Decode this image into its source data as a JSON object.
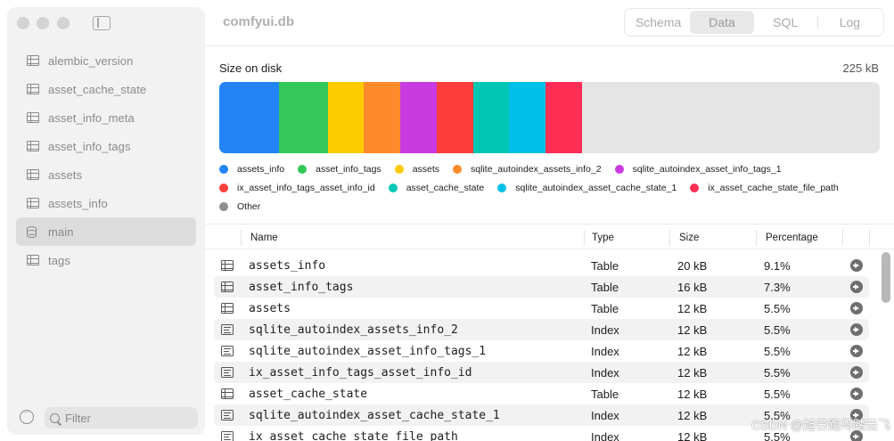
{
  "window": {
    "title": "comfyui.db"
  },
  "tabs": [
    {
      "label": "Schema",
      "active": false
    },
    {
      "label": "Data",
      "active": true
    },
    {
      "label": "SQL",
      "active": false
    },
    {
      "label": "Log",
      "active": false
    }
  ],
  "sidebar": {
    "items": [
      {
        "label": "alembic_version",
        "icon": "table-icon",
        "selected": false
      },
      {
        "label": "asset_cache_state",
        "icon": "table-icon",
        "selected": false
      },
      {
        "label": "asset_info_meta",
        "icon": "table-icon",
        "selected": false
      },
      {
        "label": "asset_info_tags",
        "icon": "table-icon",
        "selected": false
      },
      {
        "label": "assets",
        "icon": "table-icon",
        "selected": false
      },
      {
        "label": "assets_info",
        "icon": "table-icon",
        "selected": false
      },
      {
        "label": "main",
        "icon": "database-icon",
        "selected": true
      },
      {
        "label": "tags",
        "icon": "table-icon",
        "selected": false
      }
    ],
    "filter_placeholder": "Filter"
  },
  "disk": {
    "label": "Size on disk",
    "total": "225 kB",
    "segments": [
      {
        "name": "assets_info",
        "color": "#2284f6",
        "percent": 9.1
      },
      {
        "name": "asset_info_tags",
        "color": "#35c759",
        "percent": 7.3
      },
      {
        "name": "assets",
        "color": "#fecb00",
        "percent": 5.5
      },
      {
        "name": "sqlite_autoindex_assets_info_2",
        "color": "#fd8b2c",
        "percent": 5.5
      },
      {
        "name": "sqlite_autoindex_asset_info_tags_1",
        "color": "#c93be0",
        "percent": 5.5
      },
      {
        "name": "ix_asset_info_tags_asset_info_id",
        "color": "#fd3d3b",
        "percent": 5.5
      },
      {
        "name": "asset_cache_state",
        "color": "#00c7b5",
        "percent": 5.5
      },
      {
        "name": "sqlite_autoindex_asset_cache_state_1",
        "color": "#00c0e8",
        "percent": 5.5
      },
      {
        "name": "ix_asset_cache_state_file_path",
        "color": "#fe2e55",
        "percent": 5.5
      }
    ],
    "other": {
      "name": "Other",
      "color": "#8e8e8e"
    },
    "bar_background": "#e5e5e5"
  },
  "table": {
    "headers": [
      "Name",
      "Type",
      "Size",
      "Percentage"
    ],
    "rows": [
      {
        "name": "assets_info",
        "type": "Table",
        "size": "20 kB",
        "pct": "9.1%"
      },
      {
        "name": "asset_info_tags",
        "type": "Table",
        "size": "16 kB",
        "pct": "7.3%"
      },
      {
        "name": "assets",
        "type": "Table",
        "size": "12 kB",
        "pct": "5.5%"
      },
      {
        "name": "sqlite_autoindex_assets_info_2",
        "type": "Index",
        "size": "12 kB",
        "pct": "5.5%"
      },
      {
        "name": "sqlite_autoindex_asset_info_tags_1",
        "type": "Index",
        "size": "12 kB",
        "pct": "5.5%"
      },
      {
        "name": "ix_asset_info_tags_asset_info_id",
        "type": "Index",
        "size": "12 kB",
        "pct": "5.5%"
      },
      {
        "name": "asset_cache_state",
        "type": "Table",
        "size": "12 kB",
        "pct": "5.5%"
      },
      {
        "name": "sqlite_autoindex_asset_cache_state_1",
        "type": "Index",
        "size": "12 kB",
        "pct": "5.5%"
      },
      {
        "name": "ix_asset_cache_state_file_path",
        "type": "Index",
        "size": "12 kB",
        "pct": "5.5%"
      }
    ]
  },
  "watermark": "CSDN @旭日跑马踏云飞"
}
